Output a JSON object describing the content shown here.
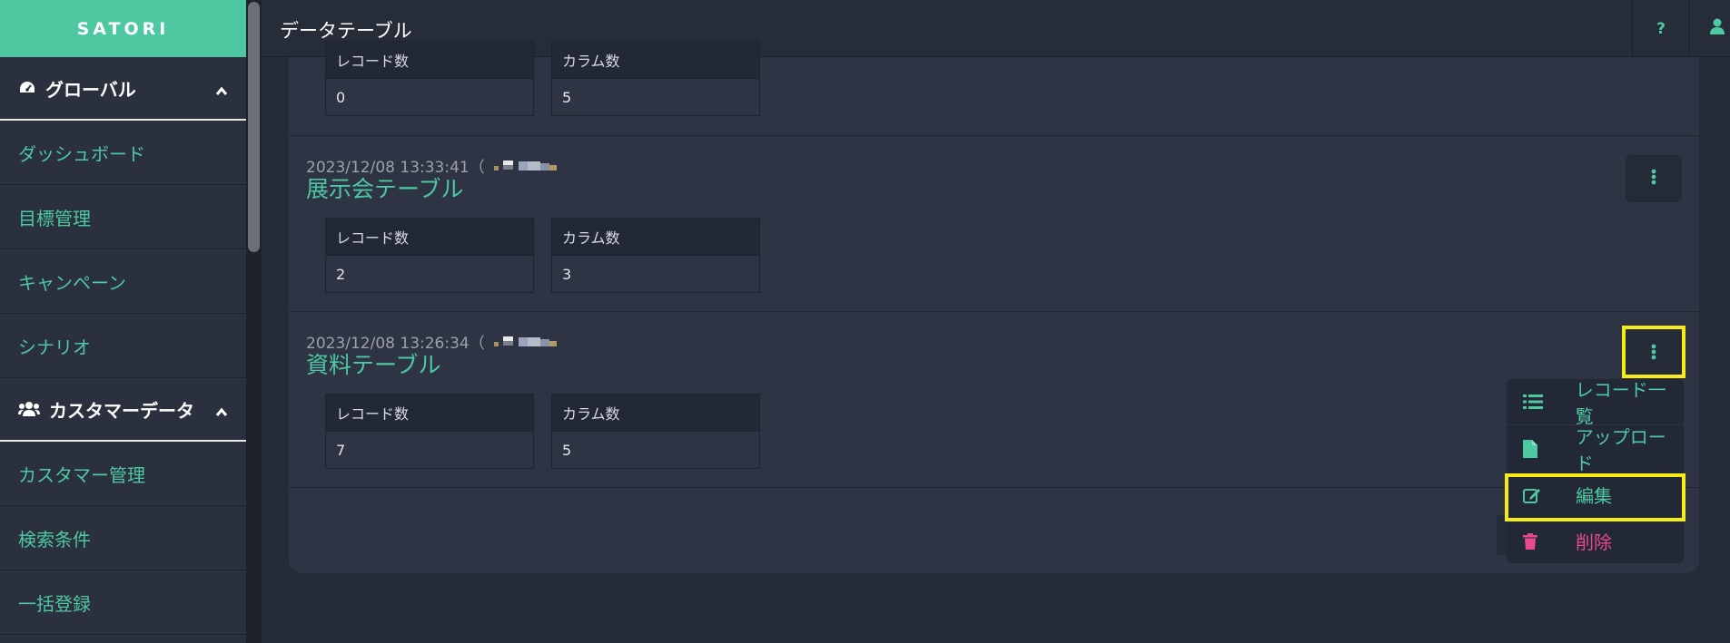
{
  "app": {
    "logo": "SATORI",
    "page_title": "データテーブル"
  },
  "header": {
    "help_label": "?"
  },
  "sidebar": {
    "sections": [
      {
        "label": "グローバル",
        "items": [
          "ダッシュボード",
          "目標管理",
          "キャンペーン",
          "シナリオ"
        ]
      },
      {
        "label": "カスタマーデータ",
        "items": [
          "カスタマー管理",
          "検索条件",
          "一括登録"
        ]
      }
    ]
  },
  "tables": [
    {
      "timestamp": "",
      "name": "",
      "records_label": "レコード数",
      "records": "0",
      "columns_label": "カラム数",
      "columns": "5"
    },
    {
      "timestamp": "2023/12/08 13:33:41（",
      "name": "展示会テーブル",
      "records_label": "レコード数",
      "records": "2",
      "columns_label": "カラム数",
      "columns": "3"
    },
    {
      "timestamp": "2023/12/08 13:26:34（",
      "name": "資料テーブル",
      "records_label": "レコード数",
      "records": "7",
      "columns_label": "カラム数",
      "columns": "5"
    }
  ],
  "menu": {
    "items": [
      {
        "label": "レコード一覧",
        "icon": "list-icon"
      },
      {
        "label": "アップロード",
        "icon": "file-icon"
      },
      {
        "label": "編集",
        "icon": "edit-icon"
      },
      {
        "label": "削除",
        "icon": "trash-icon"
      }
    ]
  },
  "colors": {
    "accent": "#4dc8a0",
    "danger": "#e94a8a",
    "highlight": "#f5eb19"
  }
}
